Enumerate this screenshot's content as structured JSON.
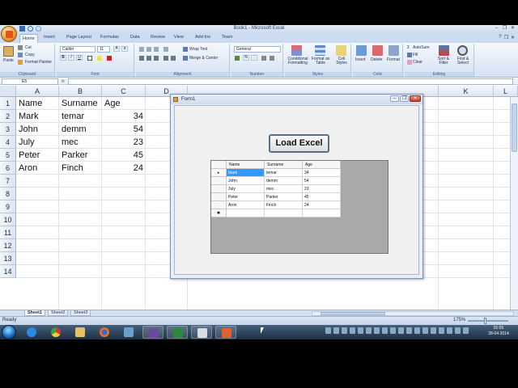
{
  "window": {
    "title": "Book1 - Microsoft Excel",
    "min_glyph": "–",
    "max_glyph": "❐",
    "close_glyph": "✕"
  },
  "ribbon": {
    "tabs": [
      "Home",
      "Insert",
      "Page Layout",
      "Formulas",
      "Data",
      "Review",
      "View",
      "Add-Ins",
      "Team"
    ],
    "active_tab": "Home",
    "clipboard": {
      "label": "Clipboard",
      "paste": "Paste",
      "cut": "Cut",
      "copy": "Copy",
      "format_painter": "Format Painter"
    },
    "font": {
      "label": "Font",
      "name": "Calibri",
      "size": "11"
    },
    "alignment": {
      "label": "Alignment",
      "wrap": "Wrap Text",
      "merge": "Merge & Center"
    },
    "number": {
      "label": "Number",
      "format": "General"
    },
    "styles": {
      "label": "Styles",
      "conditional": "Conditional Formatting",
      "format_table": "Format as Table",
      "cell_styles": "Cell Styles"
    },
    "cells": {
      "label": "Cells",
      "insert": "Insert",
      "delete": "Delete",
      "format": "Format"
    },
    "editing": {
      "label": "Editing",
      "autosum": "AutoSum",
      "fill": "Fill",
      "clear": "Clear",
      "sort": "Sort & Filter",
      "find": "Find & Select"
    }
  },
  "formula_bar": {
    "name_box": "E5",
    "fx": "fx",
    "value": ""
  },
  "sheet": {
    "columns": [
      "A",
      "B",
      "C",
      "D",
      "K",
      "L"
    ],
    "rows": [
      "1",
      "2",
      "3",
      "4",
      "5",
      "6",
      "7",
      "8",
      "9",
      "10",
      "11",
      "12",
      "13",
      "14"
    ],
    "cells": [
      [
        "Name",
        "Surname",
        "Age"
      ],
      [
        "Mark",
        "temar",
        "34"
      ],
      [
        "John",
        "demm",
        "54"
      ],
      [
        "July",
        "mec",
        "23"
      ],
      [
        "Peter",
        "Parker",
        "45"
      ],
      [
        "Aron",
        "Finch",
        "24"
      ]
    ],
    "tabs": [
      "Sheet1",
      "Sheet2",
      "Sheet3"
    ],
    "active_tab": "Sheet1"
  },
  "status": {
    "text": "Ready",
    "zoom": "175%"
  },
  "form1": {
    "title": "Form1",
    "load_button": "Load Excel",
    "grid_headers": [
      "Name",
      "Surname",
      "Age"
    ],
    "grid_rows": [
      [
        "Mark",
        "temar",
        "34"
      ],
      [
        "John",
        "demm",
        "54"
      ],
      [
        "July",
        "mec",
        "23"
      ],
      [
        "Peter",
        "Parker",
        "45"
      ],
      [
        "Aron",
        "Finch",
        "24"
      ]
    ],
    "selected_row_marker": "▸",
    "new_row_marker": "✱"
  },
  "taskbar": {
    "apps": [
      "start-orb",
      "internet-explorer-icon",
      "chrome-icon",
      "folder-icon",
      "firefox-icon",
      "app-icon",
      "visual-studio-icon",
      "excel-icon",
      "form-app-icon",
      "powerpoint-icon"
    ],
    "clock_time": "01:05",
    "clock_date": "28-04-2014"
  }
}
